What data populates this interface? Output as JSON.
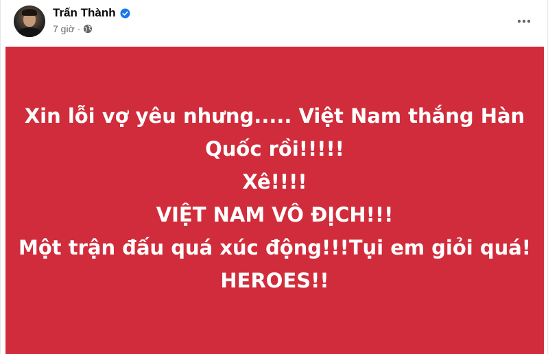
{
  "post": {
    "author": "Trấn Thành",
    "time": "7 giờ",
    "separator": "·",
    "privacy_icon": "globe-icon",
    "verified_icon": "verified-badge-icon",
    "more_icon": "more-options-icon",
    "body_lines": [
      "Xin lỗi vợ yêu nhưng..... Việt Nam thắng Hàn",
      "Quốc rồi!!!!!",
      "Xê!!!!",
      "VIỆT NAM VÔ ĐỊCH!!!",
      "Một trận đấu quá xúc động!!!Tụi em giỏi quá!",
      "HEROES!!"
    ]
  },
  "colors": {
    "banner_background": "#d12c3b",
    "banner_text": "#ffffff",
    "verified_blue": "#1877f2",
    "meta_gray": "#65676b"
  }
}
